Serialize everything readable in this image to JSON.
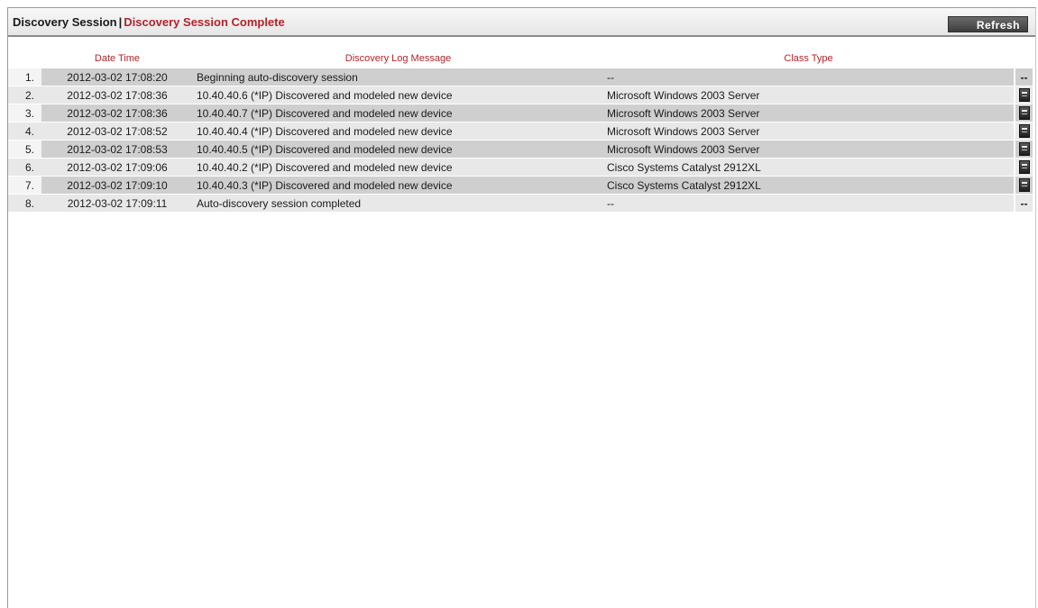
{
  "header": {
    "title": "Discovery Session",
    "separator": "|",
    "status": "Discovery Session Complete",
    "refresh_label": "Refresh"
  },
  "columns": {
    "date_time": "Date Time",
    "message": "Discovery Log Message",
    "class_type": "Class Type"
  },
  "rows": [
    {
      "num": "1.",
      "date_time": "2012-03-02 17:08:20",
      "message": "Beginning auto-discovery session",
      "class_type": "--",
      "action": "--",
      "action_icon": ""
    },
    {
      "num": "2.",
      "date_time": "2012-03-02 17:08:36",
      "message": "10.40.40.6 (*IP) Discovered and modeled new device",
      "class_type": "Microsoft Windows 2003 Server",
      "action": "",
      "action_icon": "device-properties-icon"
    },
    {
      "num": "3.",
      "date_time": "2012-03-02 17:08:36",
      "message": "10.40.40.7 (*IP) Discovered and modeled new device",
      "class_type": "Microsoft Windows 2003 Server",
      "action": "",
      "action_icon": "device-properties-icon"
    },
    {
      "num": "4.",
      "date_time": "2012-03-02 17:08:52",
      "message": "10.40.40.4 (*IP) Discovered and modeled new device",
      "class_type": "Microsoft Windows 2003 Server",
      "action": "",
      "action_icon": "device-properties-icon"
    },
    {
      "num": "5.",
      "date_time": "2012-03-02 17:08:53",
      "message": "10.40.40.5 (*IP) Discovered and modeled new device",
      "class_type": "Microsoft Windows 2003 Server",
      "action": "",
      "action_icon": "device-properties-icon"
    },
    {
      "num": "6.",
      "date_time": "2012-03-02 17:09:06",
      "message": "10.40.40.2 (*IP) Discovered and modeled new device",
      "class_type": "Cisco Systems Catalyst 2912XL",
      "action": "",
      "action_icon": "device-properties-icon"
    },
    {
      "num": "7.",
      "date_time": "2012-03-02 17:09:10",
      "message": "10.40.40.3 (*IP) Discovered and modeled new device",
      "class_type": "Cisco Systems Catalyst 2912XL",
      "action": "",
      "action_icon": "device-properties-icon"
    },
    {
      "num": "8.",
      "date_time": "2012-03-02 17:09:11",
      "message": "Auto-discovery session completed",
      "class_type": "--",
      "action": "--",
      "action_icon": ""
    }
  ],
  "colors": {
    "accent_red": "#b3222a",
    "row_dark": "#cfcfcf",
    "row_light": "#e8e8e8",
    "button_dark": "#3d3d3d"
  }
}
